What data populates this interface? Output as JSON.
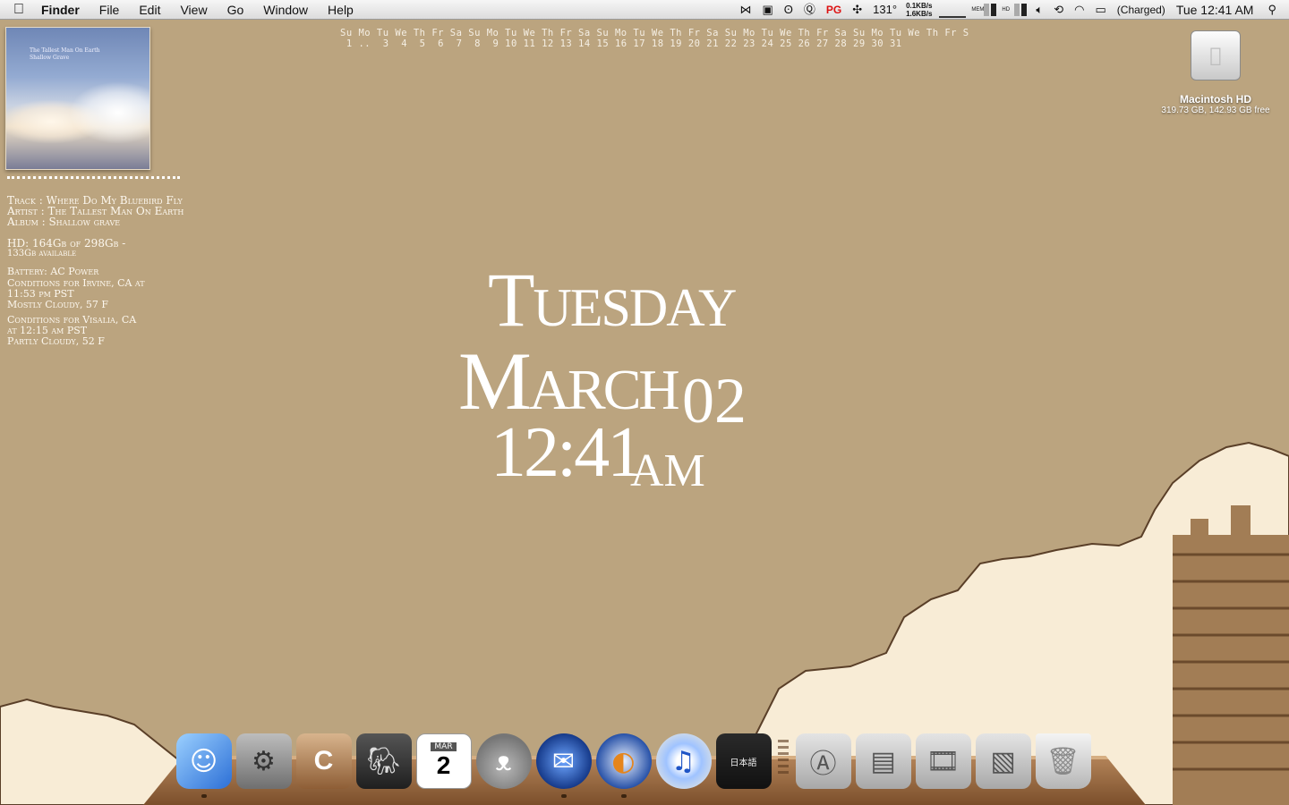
{
  "menubar": {
    "app_name": "Finder",
    "menus": [
      "File",
      "Edit",
      "View",
      "Go",
      "Window",
      "Help"
    ],
    "status": {
      "pg_label": "PG",
      "temperature": "131°",
      "net_up": "0.1KB/s",
      "net_down": "1.6KB/s",
      "mem_label": "MEM",
      "hd_label": "HD",
      "battery": "(Charged)",
      "clock": "Tue 12:41 AM"
    }
  },
  "calendar": {
    "weekdays": "Su Mo Tu We Th Fr Sa Su Mo Tu We Th Fr Sa Su Mo Tu We Th Fr Sa Su Mo Tu We Th Fr Sa Su Mo Tu We Th Fr S",
    "days": " 1 ..  3  4  5  6  7  8  9 10 11 12 13 14 15 16 17 18 19 20 21 22 23 24 25 26 27 28 29 30 31"
  },
  "album": {
    "cover_text": [
      "The Tallest Man On Earth",
      "Shallow Grave"
    ]
  },
  "nowplaying": {
    "track": "Track  : Where Do My Bluebird Fly",
    "artist": "Artist : The Tallest Man On Earth",
    "album": "Album  : Shallow grave"
  },
  "system": {
    "hd_line1": "HD: 164Gb of 298Gb -",
    "hd_line2": "133Gb available",
    "battery": "Battery: AC Power"
  },
  "weather": [
    {
      "line1": "Conditions for Irvine, CA at",
      "line2": "11:53 pm PST",
      "line3": "Mostly Cloudy, 57 F"
    },
    {
      "line1": "Conditions for Visalia, CA",
      "line2": "at 12:15 am PST",
      "line3": "Partly Cloudy, 52 F"
    }
  ],
  "clock": {
    "day": "Tuesday",
    "month": "March",
    "date": "02",
    "time": "12:41",
    "ampm": "AM"
  },
  "desktop": {
    "hd_name": "Macintosh HD",
    "hd_info": "319.73 GB, 142.93 GB free"
  },
  "dock": {
    "calendar_month": "MAR",
    "calendar_day": "2",
    "notebook_label": "日本語"
  },
  "colors": {
    "wallpaper": "#bba47f",
    "cloud": "#f8ecd6",
    "cloud_outline": "#5a3f28"
  }
}
